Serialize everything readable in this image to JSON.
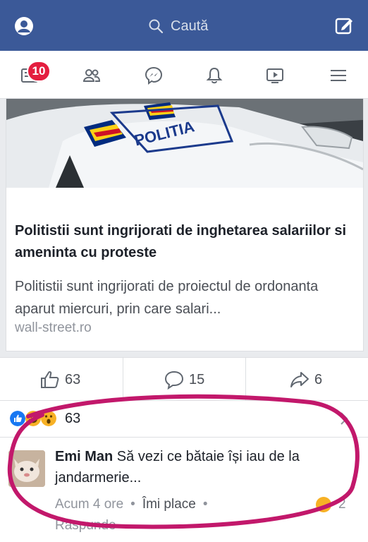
{
  "header": {
    "search_label": "Caută",
    "notification_count": "10"
  },
  "article": {
    "title": "Politistii sunt ingrijorati de inghetarea salariilor si ameninta cu proteste",
    "description": "Politistii sunt ingrijorati de proiectul de ordonanta aparut miercuri, prin care salari...",
    "domain": "wall-street.ro",
    "image_text": "POLITIA"
  },
  "actions": {
    "likes": "63",
    "comments": "15",
    "shares": "6"
  },
  "reactions": {
    "count": "63"
  },
  "comment": {
    "author": "Emi Man",
    "text": " Să vezi ce bătaie își iau de la jandarmerie...",
    "time": "Acum 4 ore",
    "like": "Îmi place",
    "reply": "Răspunde",
    "reaction_count": "2"
  },
  "colors": {
    "brand": "#3b5998",
    "badge": "#e41e3f",
    "highlight": "#c2186b"
  }
}
